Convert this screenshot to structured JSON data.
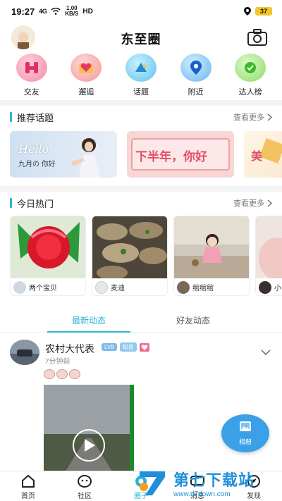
{
  "status_bar": {
    "time": "19:27",
    "signal": "4G",
    "speed_value": "1.00",
    "speed_unit": "KB/S",
    "hd": "HD",
    "battery": "37"
  },
  "header": {
    "title": "东至圈"
  },
  "quick_nav": [
    {
      "label": "交友",
      "icon": "friends-icon",
      "color": "#f58aa8"
    },
    {
      "label": "邂逅",
      "icon": "heart-icon",
      "color": "#f49a9a"
    },
    {
      "label": "话题",
      "icon": "topic-icon",
      "color": "#5ec4ea"
    },
    {
      "label": "附近",
      "icon": "location-icon",
      "color": "#6ab6f0"
    },
    {
      "label": "达人榜",
      "icon": "leaderboard-icon",
      "color": "#8ddc6a"
    }
  ],
  "recommended_topics": {
    "title": "推荐话题",
    "more": "查看更多",
    "cards": [
      {
        "script": "Hello",
        "caption": "九月の 你好"
      },
      {
        "caption": "下半年，你好"
      },
      {
        "caption": "美"
      }
    ]
  },
  "hot_today": {
    "title": "今日热门",
    "more": "查看更多",
    "cards": [
      {
        "name": "两个宝贝"
      },
      {
        "name": "麦迪"
      },
      {
        "name": "绾绾绾"
      },
      {
        "name": "小"
      }
    ]
  },
  "feed_tabs": [
    {
      "label": "最新动态",
      "active": true
    },
    {
      "label": "好友动态",
      "active": false
    }
  ],
  "post": {
    "author": "农村大代表",
    "level_badge": "LV8",
    "tag_badge": "知县",
    "time": "7分钟前"
  },
  "album_fab": {
    "label": "相册"
  },
  "bottom_nav": [
    {
      "label": "首页",
      "icon": "home-icon",
      "active": false
    },
    {
      "label": "社区",
      "icon": "community-icon",
      "active": false
    },
    {
      "label": "圈子",
      "icon": "circle-icon",
      "active": true
    },
    {
      "label": "消息",
      "icon": "message-icon",
      "active": false
    },
    {
      "label": "发现",
      "icon": "discover-icon",
      "active": false
    }
  ],
  "watermark": {
    "title": "第七下载站",
    "url": "www.d7down.com"
  }
}
